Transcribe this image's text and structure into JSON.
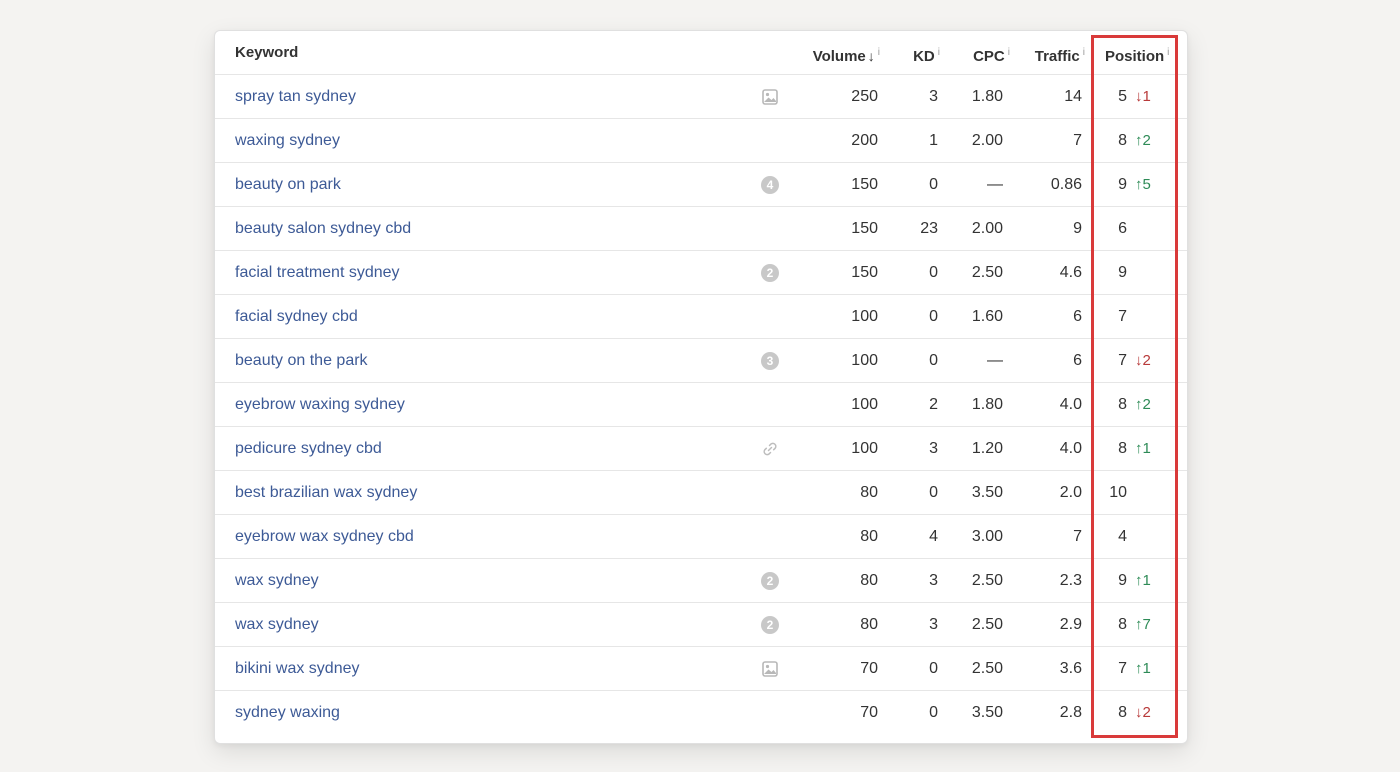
{
  "table": {
    "headers": {
      "keyword": "Keyword",
      "volume": "Volume",
      "volume_sort": "↓",
      "kd": "KD",
      "cpc": "CPC",
      "traffic": "Traffic",
      "position": "Position",
      "info": "i"
    },
    "rows": [
      {
        "keyword": "spray tan sydney",
        "feature_icon": "image-icon",
        "badge": "",
        "volume": "250",
        "kd": "3",
        "cpc": "1.80",
        "traffic": "14",
        "position": "5",
        "change": "↓1",
        "change_dir": "down"
      },
      {
        "keyword": "waxing sydney",
        "feature_icon": "",
        "badge": "",
        "volume": "200",
        "kd": "1",
        "cpc": "2.00",
        "traffic": "7",
        "position": "8",
        "change": "↑2",
        "change_dir": "up"
      },
      {
        "keyword": "beauty on park",
        "feature_icon": "count-badge-icon",
        "badge": "4",
        "volume": "150",
        "kd": "0",
        "cpc": "—",
        "traffic": "0.86",
        "position": "9",
        "change": "↑5",
        "change_dir": "up"
      },
      {
        "keyword": "beauty salon sydney cbd",
        "feature_icon": "",
        "badge": "",
        "volume": "150",
        "kd": "23",
        "cpc": "2.00",
        "traffic": "9",
        "position": "6",
        "change": "",
        "change_dir": ""
      },
      {
        "keyword": "facial treatment sydney",
        "feature_icon": "count-badge-icon",
        "badge": "2",
        "volume": "150",
        "kd": "0",
        "cpc": "2.50",
        "traffic": "4.6",
        "position": "9",
        "change": "",
        "change_dir": ""
      },
      {
        "keyword": "facial sydney cbd",
        "feature_icon": "",
        "badge": "",
        "volume": "100",
        "kd": "0",
        "cpc": "1.60",
        "traffic": "6",
        "position": "7",
        "change": "",
        "change_dir": ""
      },
      {
        "keyword": "beauty on the park",
        "feature_icon": "count-badge-icon",
        "badge": "3",
        "volume": "100",
        "kd": "0",
        "cpc": "—",
        "traffic": "6",
        "position": "7",
        "change": "↓2",
        "change_dir": "down"
      },
      {
        "keyword": "eyebrow waxing sydney",
        "feature_icon": "",
        "badge": "",
        "volume": "100",
        "kd": "2",
        "cpc": "1.80",
        "traffic": "4.0",
        "position": "8",
        "change": "↑2",
        "change_dir": "up"
      },
      {
        "keyword": "pedicure sydney cbd",
        "feature_icon": "link-icon",
        "badge": "",
        "volume": "100",
        "kd": "3",
        "cpc": "1.20",
        "traffic": "4.0",
        "position": "8",
        "change": "↑1",
        "change_dir": "up"
      },
      {
        "keyword": "best brazilian wax sydney",
        "feature_icon": "",
        "badge": "",
        "volume": "80",
        "kd": "0",
        "cpc": "3.50",
        "traffic": "2.0",
        "position": "10",
        "change": "",
        "change_dir": ""
      },
      {
        "keyword": "eyebrow wax sydney cbd",
        "feature_icon": "",
        "badge": "",
        "volume": "80",
        "kd": "4",
        "cpc": "3.00",
        "traffic": "7",
        "position": "4",
        "change": "",
        "change_dir": ""
      },
      {
        "keyword": "wax sydney",
        "feature_icon": "count-badge-icon",
        "badge": "2",
        "volume": "80",
        "kd": "3",
        "cpc": "2.50",
        "traffic": "2.3",
        "position": "9",
        "change": "↑1",
        "change_dir": "up"
      },
      {
        "keyword": "wax sydney",
        "feature_icon": "count-badge-icon",
        "badge": "2",
        "volume": "80",
        "kd": "3",
        "cpc": "2.50",
        "traffic": "2.9",
        "position": "8",
        "change": "↑7",
        "change_dir": "up"
      },
      {
        "keyword": "bikini wax sydney",
        "feature_icon": "image-icon",
        "badge": "",
        "volume": "70",
        "kd": "0",
        "cpc": "2.50",
        "traffic": "3.6",
        "position": "7",
        "change": "↑1",
        "change_dir": "up"
      },
      {
        "keyword": "sydney waxing",
        "feature_icon": "",
        "badge": "",
        "volume": "70",
        "kd": "0",
        "cpc": "3.50",
        "traffic": "2.8",
        "position": "8",
        "change": "↓2",
        "change_dir": "down"
      }
    ]
  },
  "colors": {
    "keyword_link": "#3d5a96",
    "change_up": "#2e8b57",
    "change_down": "#b83a3a",
    "highlight": "#d93a3a"
  }
}
